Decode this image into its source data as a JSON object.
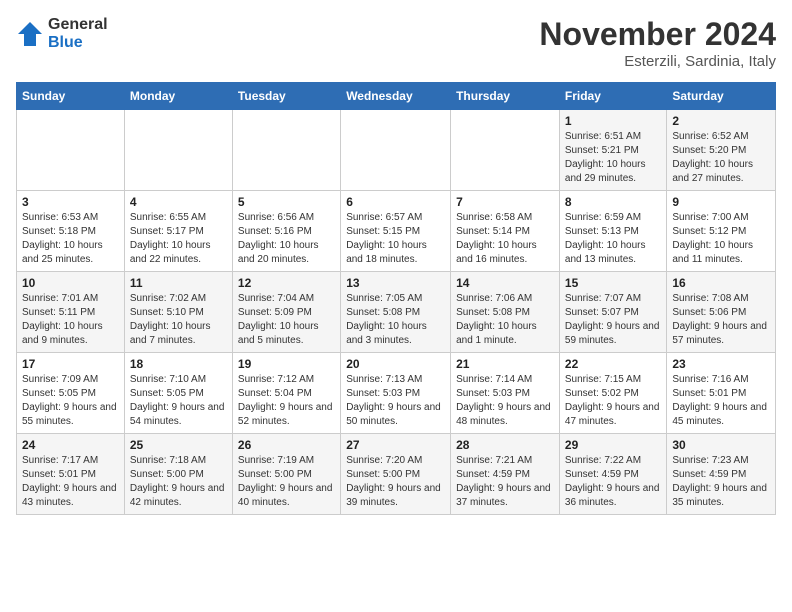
{
  "header": {
    "logo_general": "General",
    "logo_blue": "Blue",
    "month_title": "November 2024",
    "location": "Esterzili, Sardinia, Italy"
  },
  "days_of_week": [
    "Sunday",
    "Monday",
    "Tuesday",
    "Wednesday",
    "Thursday",
    "Friday",
    "Saturday"
  ],
  "weeks": [
    [
      {
        "day": "",
        "info": ""
      },
      {
        "day": "",
        "info": ""
      },
      {
        "day": "",
        "info": ""
      },
      {
        "day": "",
        "info": ""
      },
      {
        "day": "",
        "info": ""
      },
      {
        "day": "1",
        "info": "Sunrise: 6:51 AM\nSunset: 5:21 PM\nDaylight: 10 hours and 29 minutes."
      },
      {
        "day": "2",
        "info": "Sunrise: 6:52 AM\nSunset: 5:20 PM\nDaylight: 10 hours and 27 minutes."
      }
    ],
    [
      {
        "day": "3",
        "info": "Sunrise: 6:53 AM\nSunset: 5:18 PM\nDaylight: 10 hours and 25 minutes."
      },
      {
        "day": "4",
        "info": "Sunrise: 6:55 AM\nSunset: 5:17 PM\nDaylight: 10 hours and 22 minutes."
      },
      {
        "day": "5",
        "info": "Sunrise: 6:56 AM\nSunset: 5:16 PM\nDaylight: 10 hours and 20 minutes."
      },
      {
        "day": "6",
        "info": "Sunrise: 6:57 AM\nSunset: 5:15 PM\nDaylight: 10 hours and 18 minutes."
      },
      {
        "day": "7",
        "info": "Sunrise: 6:58 AM\nSunset: 5:14 PM\nDaylight: 10 hours and 16 minutes."
      },
      {
        "day": "8",
        "info": "Sunrise: 6:59 AM\nSunset: 5:13 PM\nDaylight: 10 hours and 13 minutes."
      },
      {
        "day": "9",
        "info": "Sunrise: 7:00 AM\nSunset: 5:12 PM\nDaylight: 10 hours and 11 minutes."
      }
    ],
    [
      {
        "day": "10",
        "info": "Sunrise: 7:01 AM\nSunset: 5:11 PM\nDaylight: 10 hours and 9 minutes."
      },
      {
        "day": "11",
        "info": "Sunrise: 7:02 AM\nSunset: 5:10 PM\nDaylight: 10 hours and 7 minutes."
      },
      {
        "day": "12",
        "info": "Sunrise: 7:04 AM\nSunset: 5:09 PM\nDaylight: 10 hours and 5 minutes."
      },
      {
        "day": "13",
        "info": "Sunrise: 7:05 AM\nSunset: 5:08 PM\nDaylight: 10 hours and 3 minutes."
      },
      {
        "day": "14",
        "info": "Sunrise: 7:06 AM\nSunset: 5:08 PM\nDaylight: 10 hours and 1 minute."
      },
      {
        "day": "15",
        "info": "Sunrise: 7:07 AM\nSunset: 5:07 PM\nDaylight: 9 hours and 59 minutes."
      },
      {
        "day": "16",
        "info": "Sunrise: 7:08 AM\nSunset: 5:06 PM\nDaylight: 9 hours and 57 minutes."
      }
    ],
    [
      {
        "day": "17",
        "info": "Sunrise: 7:09 AM\nSunset: 5:05 PM\nDaylight: 9 hours and 55 minutes."
      },
      {
        "day": "18",
        "info": "Sunrise: 7:10 AM\nSunset: 5:05 PM\nDaylight: 9 hours and 54 minutes."
      },
      {
        "day": "19",
        "info": "Sunrise: 7:12 AM\nSunset: 5:04 PM\nDaylight: 9 hours and 52 minutes."
      },
      {
        "day": "20",
        "info": "Sunrise: 7:13 AM\nSunset: 5:03 PM\nDaylight: 9 hours and 50 minutes."
      },
      {
        "day": "21",
        "info": "Sunrise: 7:14 AM\nSunset: 5:03 PM\nDaylight: 9 hours and 48 minutes."
      },
      {
        "day": "22",
        "info": "Sunrise: 7:15 AM\nSunset: 5:02 PM\nDaylight: 9 hours and 47 minutes."
      },
      {
        "day": "23",
        "info": "Sunrise: 7:16 AM\nSunset: 5:01 PM\nDaylight: 9 hours and 45 minutes."
      }
    ],
    [
      {
        "day": "24",
        "info": "Sunrise: 7:17 AM\nSunset: 5:01 PM\nDaylight: 9 hours and 43 minutes."
      },
      {
        "day": "25",
        "info": "Sunrise: 7:18 AM\nSunset: 5:00 PM\nDaylight: 9 hours and 42 minutes."
      },
      {
        "day": "26",
        "info": "Sunrise: 7:19 AM\nSunset: 5:00 PM\nDaylight: 9 hours and 40 minutes."
      },
      {
        "day": "27",
        "info": "Sunrise: 7:20 AM\nSunset: 5:00 PM\nDaylight: 9 hours and 39 minutes."
      },
      {
        "day": "28",
        "info": "Sunrise: 7:21 AM\nSunset: 4:59 PM\nDaylight: 9 hours and 37 minutes."
      },
      {
        "day": "29",
        "info": "Sunrise: 7:22 AM\nSunset: 4:59 PM\nDaylight: 9 hours and 36 minutes."
      },
      {
        "day": "30",
        "info": "Sunrise: 7:23 AM\nSunset: 4:59 PM\nDaylight: 9 hours and 35 minutes."
      }
    ]
  ]
}
